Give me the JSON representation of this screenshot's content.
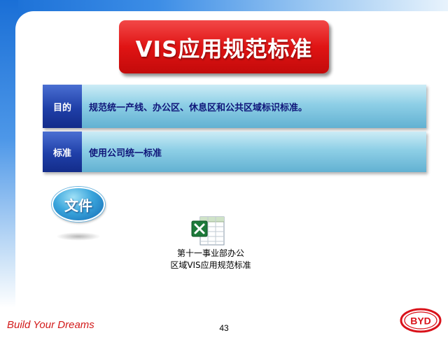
{
  "slide": {
    "title": "VIS应用规范标准",
    "rows": [
      {
        "label": "目的",
        "text": "规范统一产线、办公区、休息区和公共区域标识标准。"
      },
      {
        "label": "标准",
        "text": "使用公司统一标准"
      }
    ],
    "badge": "文件",
    "file": {
      "icon": "excel-file-icon",
      "caption_line1": "第十一事业部办公",
      "caption_line2": "区域VIS应用规范标准"
    }
  },
  "footer": {
    "slogan": "Build Your Dreams",
    "page_number": "43",
    "logo_text": "BYD",
    "logo_icon": "byd-logo-icon"
  },
  "colors": {
    "title_red": "#e01414",
    "row_label_blue": "#1f3fa8",
    "row_body_cyan": "#8ecfe6",
    "row_text_navy": "#10167a",
    "slogan_red": "#d21a1a",
    "logo_red": "#d9121a"
  }
}
